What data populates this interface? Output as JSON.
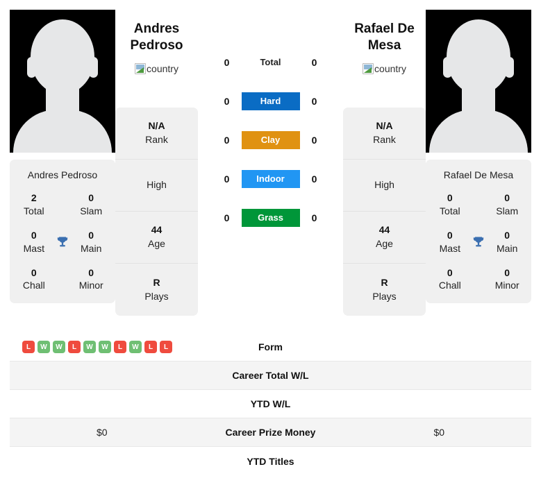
{
  "players": {
    "left": {
      "display_name": "Andres\nPedroso",
      "name_line1": "Andres",
      "name_line2": "Pedroso",
      "flag_alt": "country",
      "card_name": "Andres Pedroso",
      "titles": {
        "total_value": "2",
        "total_label": "Total",
        "slam_value": "0",
        "slam_label": "Slam",
        "mast_value": "0",
        "mast_label": "Mast",
        "main_value": "0",
        "main_label": "Main",
        "chall_value": "0",
        "chall_label": "Chall",
        "minor_value": "0",
        "minor_label": "Minor"
      },
      "stats": [
        {
          "value": "N/A",
          "label": "Rank"
        },
        {
          "value": "",
          "label": "High"
        },
        {
          "value": "44",
          "label": "Age"
        },
        {
          "value": "R",
          "label": "Plays"
        }
      ],
      "h2h": {
        "total": "0",
        "hard": "0",
        "clay": "0",
        "indoor": "0",
        "grass": "0"
      },
      "form": [
        "L",
        "W",
        "W",
        "L",
        "W",
        "W",
        "L",
        "W",
        "L",
        "L"
      ],
      "career_total_wl": "",
      "ytd_wl": "",
      "career_prize_money": "$0",
      "ytd_titles": ""
    },
    "right": {
      "display_name": "Rafael De\nMesa",
      "name_line1": "Rafael De",
      "name_line2": "Mesa",
      "flag_alt": "country",
      "card_name": "Rafael De Mesa",
      "titles": {
        "total_value": "0",
        "total_label": "Total",
        "slam_value": "0",
        "slam_label": "Slam",
        "mast_value": "0",
        "mast_label": "Mast",
        "main_value": "0",
        "main_label": "Main",
        "chall_value": "0",
        "chall_label": "Chall",
        "minor_value": "0",
        "minor_label": "Minor"
      },
      "stats": [
        {
          "value": "N/A",
          "label": "Rank"
        },
        {
          "value": "",
          "label": "High"
        },
        {
          "value": "44",
          "label": "Age"
        },
        {
          "value": "R",
          "label": "Plays"
        }
      ],
      "h2h": {
        "total": "0",
        "hard": "0",
        "clay": "0",
        "indoor": "0",
        "grass": "0"
      },
      "form": [],
      "career_total_wl": "",
      "ytd_wl": "",
      "career_prize_money": "$0",
      "ytd_titles": ""
    }
  },
  "head_to_head": {
    "total_label": "Total",
    "surfaces": [
      {
        "key": "hard",
        "label": "Hard",
        "color": "#0a6cc4"
      },
      {
        "key": "clay",
        "label": "Clay",
        "color": "#e09212"
      },
      {
        "key": "indoor",
        "label": "Indoor",
        "color": "#2196f3"
      },
      {
        "key": "grass",
        "label": "Grass",
        "color": "#009639"
      }
    ]
  },
  "comparison_table": {
    "rows": [
      {
        "label": "Form",
        "left": "",
        "right": ""
      },
      {
        "label": "Career Total W/L",
        "left": "",
        "right": ""
      },
      {
        "label": "YTD W/L",
        "left": "",
        "right": ""
      },
      {
        "label": "Career Prize Money",
        "left": "$0",
        "right": "$0"
      },
      {
        "label": "YTD Titles",
        "left": "",
        "right": ""
      }
    ]
  },
  "colors": {
    "win_badge": "#6fbf73",
    "loss_badge": "#ef4b3e",
    "panel_bg": "#f0f0f0",
    "stripe_bg": "#f4f4f4",
    "trophy": "#3b6fb0"
  },
  "icons": {
    "trophy": "trophy-icon",
    "broken_image": "broken-image-icon"
  }
}
